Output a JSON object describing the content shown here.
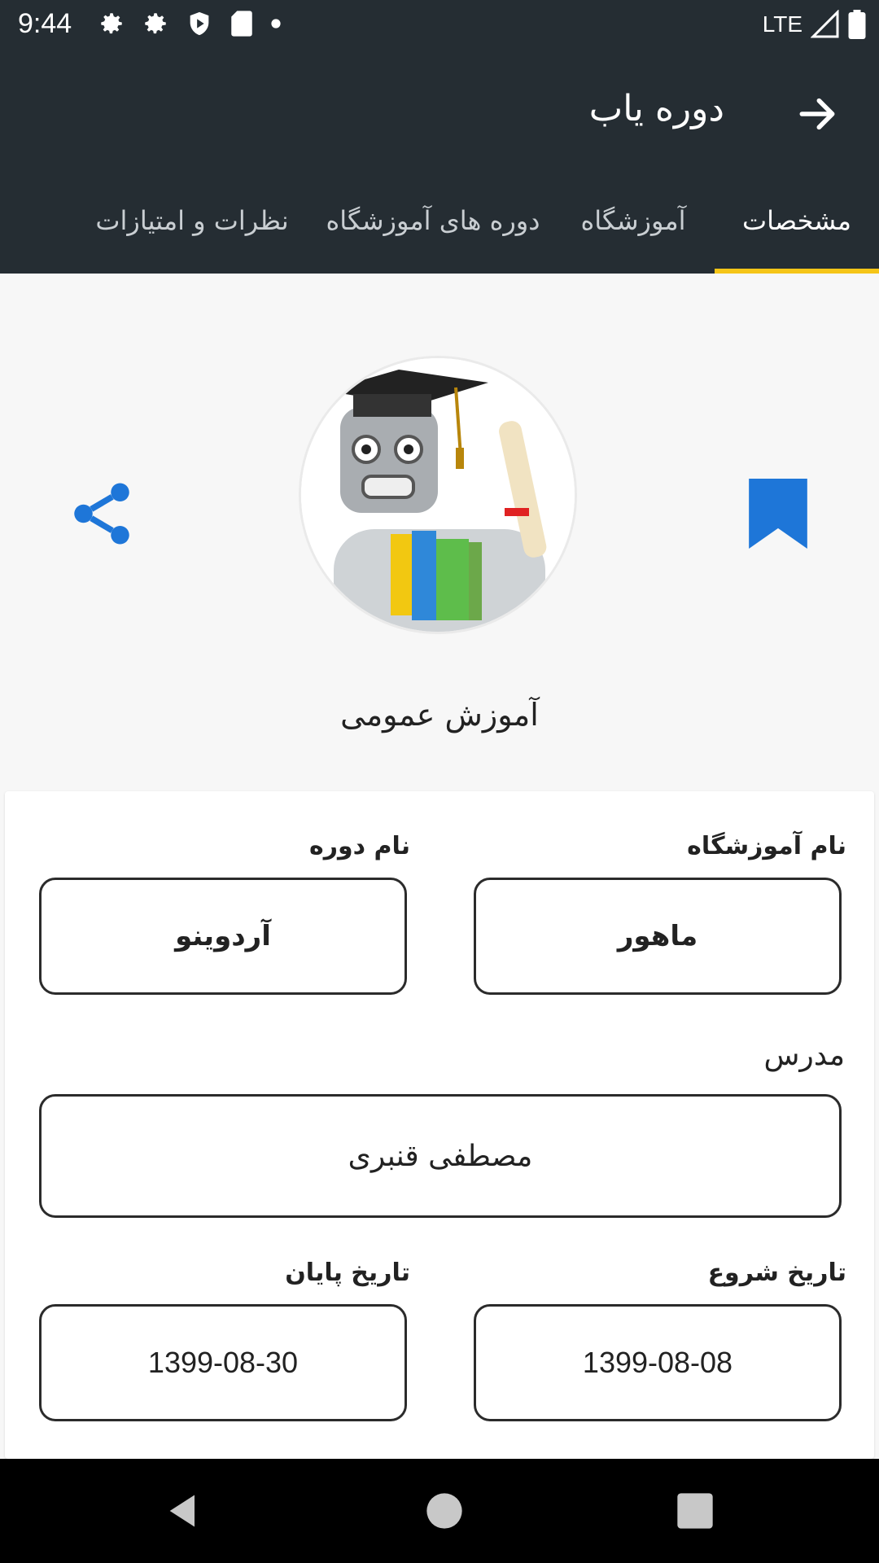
{
  "status": {
    "time": "9:44",
    "network": "LTE",
    "left_icons": [
      "settings-icon",
      "settings-icon",
      "shield-icon",
      "sd-card-icon",
      "dot-icon"
    ],
    "right_icons": [
      "signal-icon",
      "battery-icon"
    ]
  },
  "appbar": {
    "title": "دوره یاب",
    "back_icon": "arrow-right-icon"
  },
  "tabs": [
    {
      "label": "مشخصات",
      "active": true
    },
    {
      "label": "آموزشگاه",
      "active": false
    },
    {
      "label": "دوره های آموزشگاه",
      "active": false
    },
    {
      "label": "نظرات و امتیازات",
      "active": false
    }
  ],
  "hero": {
    "avatar": "robot-graduate-image",
    "share_icon": "share-icon",
    "bookmark_icon": "bookmark-icon",
    "category": "آموزش عمومی"
  },
  "details": {
    "institute_label": "نام آموزشگاه",
    "institute_value": "ماهور",
    "course_label": "نام دوره",
    "course_value": "آردوینو",
    "teacher_label": "مدرس",
    "teacher_value": "مصطفی قنبری",
    "start_label": "تاریخ شروع",
    "start_value": "1399-08-08",
    "end_label": "تاریخ پایان",
    "end_value": "1399-08-30"
  },
  "colors": {
    "appbar": "#252d33",
    "tab_indicator": "#f5c518",
    "accent": "#1e76d8"
  }
}
